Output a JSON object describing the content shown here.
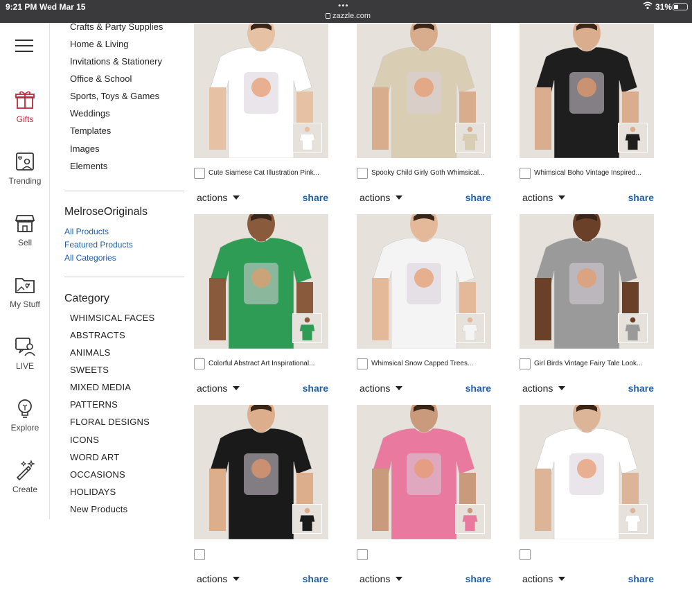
{
  "status": {
    "time": "9:21 PM",
    "date": "Wed Mar 15",
    "url": "zazzle.com",
    "battery": "31%",
    "battery_level": 0.31
  },
  "rail": [
    {
      "label": "Gifts",
      "icon": "gift-icon",
      "active": true
    },
    {
      "label": "Trending",
      "icon": "trending-icon"
    },
    {
      "label": "Sell",
      "icon": "store-icon"
    },
    {
      "label": "My Stuff",
      "icon": "folder-heart-icon"
    },
    {
      "label": "LIVE",
      "icon": "live-icon"
    },
    {
      "label": "Explore",
      "icon": "bulb-icon"
    },
    {
      "label": "Create",
      "icon": "magic-wand-icon"
    }
  ],
  "sidebar": {
    "categories_top": [
      "Crafts & Party Supplies",
      "Home & Living",
      "Invitations & Stationery",
      "Office & School",
      "Sports, Toys & Games",
      "Weddings",
      "Templates",
      "Images",
      "Elements"
    ],
    "store_name": "MelroseOriginals",
    "store_links": [
      "All Products",
      "Featured Products",
      "All Categories"
    ],
    "category_heading": "Category",
    "categories": [
      "WHIMSICAL FACES",
      "ABSTRACTS",
      "ANIMALS",
      "SWEETS",
      "MIXED MEDIA",
      "PATTERNS",
      "FLORAL DESIGNS",
      "ICONS",
      "WORD ART",
      "OCCASIONS",
      "HOLIDAYS",
      "New Products"
    ]
  },
  "product_actions": {
    "actions_label": "actions",
    "share_label": "share"
  },
  "products": [
    {
      "title": "Cute Siamese Cat Illustration Pink...",
      "shirt_color": "#ffffff",
      "skin": "#e6c1a4"
    },
    {
      "title": "Spooky Child Girly Goth Whimsical...",
      "shirt_color": "#d9cdb3",
      "skin": "#d7ad8e"
    },
    {
      "title": "Whimsical Boho Vintage Inspired...",
      "shirt_color": "#1e1e1e",
      "skin": "#d9ad8d"
    },
    {
      "title": "Colorful Abstract Art Inspirational...",
      "shirt_color": "#2e9c55",
      "skin": "#8a5a3c"
    },
    {
      "title": "Whimsical Snow Capped Trees...",
      "shirt_color": "#f4f4f4",
      "skin": "#e3b99a"
    },
    {
      "title": "Girl Birds Vintage Fairy Tale Look...",
      "shirt_color": "#9a9a9a",
      "skin": "#6b4028"
    },
    {
      "title": "",
      "shirt_color": "#1a1a1a",
      "skin": "#dcae8c"
    },
    {
      "title": "",
      "shirt_color": "#e9799f",
      "skin": "#c99a7b"
    },
    {
      "title": "",
      "shirt_color": "#ffffff",
      "skin": "#dcb497"
    }
  ]
}
